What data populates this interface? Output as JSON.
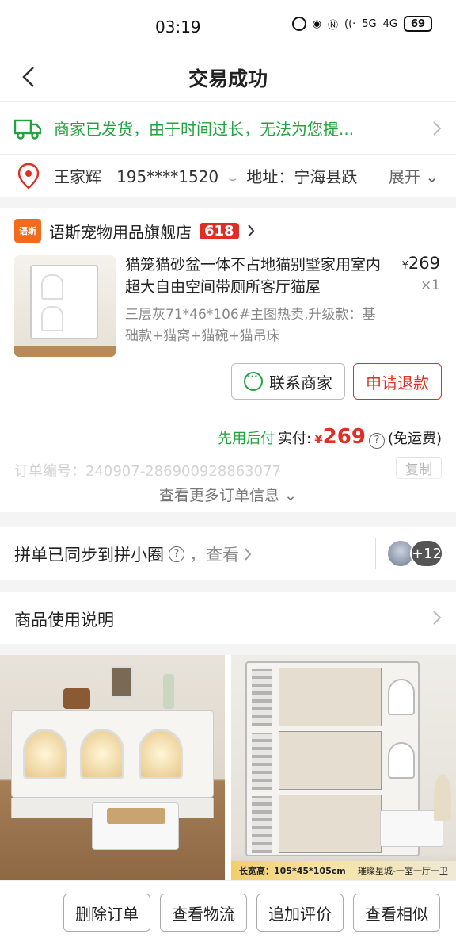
{
  "status_bar": {
    "time": "03:19",
    "battery": "69",
    "signal_labels": [
      "5G",
      "4G"
    ]
  },
  "header": {
    "title": "交易成功"
  },
  "shipping": {
    "message": "商家已发货，由于时间过长，无法为您提...",
    "name": "王家辉",
    "phone": "195****1520",
    "address_prefix": "地址：宁海县跃",
    "expand_label": "展开"
  },
  "order": {
    "shop_logo_text": "语斯",
    "shop_name": "语斯宠物用品旗舰店",
    "shop_badge": "618",
    "product": {
      "title": "猫笼猫砂盆一体不占地猫别墅家用室内超大自由空间带厕所客厅猫屋",
      "price_symbol": "¥",
      "price": "269",
      "quantity": "×1",
      "sku": "三层灰71*46*106#主图热卖,升级款：基础款+猫窝+猫碗+猫吊床"
    },
    "contact_button": "联系商家",
    "refund_button": "申请退款",
    "pay_later_label": "先用后付",
    "paid_label": "实付:",
    "paid_symbol": "¥",
    "paid_amount": "269",
    "shipping_fee_note": "(免运费)",
    "order_number": "订单编号：240907-286900928863077",
    "copy_button": "复制",
    "more_info": "查看更多订单信息"
  },
  "group_sync": {
    "text": "拼单已同步到拼小圈",
    "view_label": "，查看",
    "plus_count": "+12"
  },
  "instructions": {
    "label": "商品使用说明"
  },
  "photos": {
    "caption_left": "长宽高：105*45*105cm",
    "caption_right": "璀璨星城-一室一厅一卫"
  },
  "bottom_actions": {
    "delete": "删除订单",
    "logistics": "查看物流",
    "review": "追加评价",
    "similar": "查看相似"
  },
  "colors": {
    "green": "#21a33d",
    "red": "#e02e24",
    "shop_logo": "#f26b1d"
  }
}
